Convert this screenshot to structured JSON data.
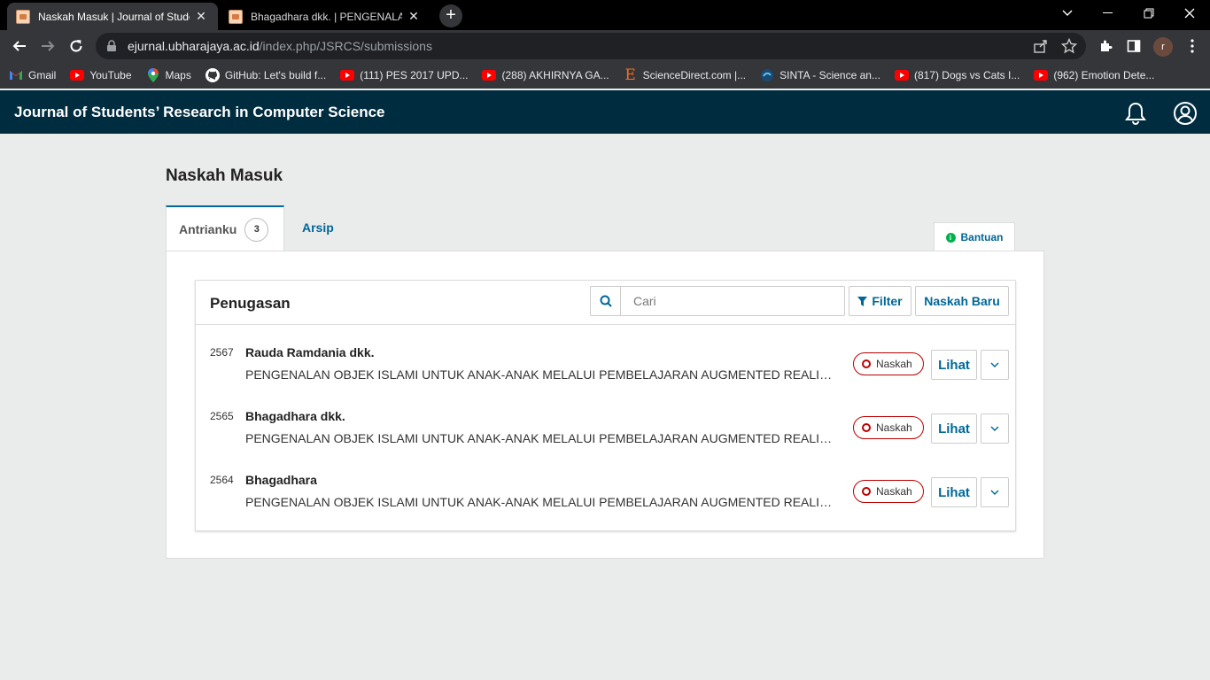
{
  "browser": {
    "tabs": [
      {
        "title": "Naskah Masuk | Journal of Students",
        "active": true
      },
      {
        "title": "Bhagadhara dkk. | PENGENALAN",
        "active": false
      }
    ],
    "url_host": "ejurnal.ubharajaya.ac.id",
    "url_path": "/index.php/JSRCS/submissions",
    "profile_initial": "r",
    "bookmarks": [
      {
        "label": "Gmail",
        "icon": "gmail-icon"
      },
      {
        "label": "YouTube",
        "icon": "youtube-icon"
      },
      {
        "label": "Maps",
        "icon": "maps-icon"
      },
      {
        "label": "GitHub: Let's build f...",
        "icon": "github-icon"
      },
      {
        "label": "(111) PES 2017 UPD...",
        "icon": "youtube-icon"
      },
      {
        "label": "(288) AKHIRNYA GA...",
        "icon": "youtube-icon"
      },
      {
        "label": "ScienceDirect.com |...",
        "icon": "elsevier-icon"
      },
      {
        "label": "SINTA - Science an...",
        "icon": "sinta-icon"
      },
      {
        "label": "(817) Dogs vs Cats I...",
        "icon": "youtube-icon"
      },
      {
        "label": "(962) Emotion Dete...",
        "icon": "youtube-icon"
      }
    ]
  },
  "app": {
    "title": "Journal of Students’ Research in Computer Science"
  },
  "page": {
    "title": "Naskah Masuk",
    "tabs": {
      "my_queue": "Antrianku",
      "my_queue_count": "3",
      "archive": "Arsip"
    },
    "help_label": "Bantuan"
  },
  "list": {
    "title": "Penugasan",
    "search_placeholder": "Cari",
    "filter_label": "Filter",
    "new_label": "Naskah Baru",
    "view_label": "Lihat",
    "items": [
      {
        "id": "2567",
        "author": "Rauda Ramdania dkk.",
        "title": "PENGENALAN OBJEK ISLAMI UNTUK ANAK-ANAK MELALUI PEMBELAJARAN AUGMENTED REALITY (A...",
        "stage": "Naskah"
      },
      {
        "id": "2565",
        "author": "Bhagadhara dkk.",
        "title": "PENGENALAN OBJEK ISLAMI UNTUK ANAK-ANAK MELALUI PEMBELAJARAN AUGMENTED REALITY (A...",
        "stage": "Naskah"
      },
      {
        "id": "2564",
        "author": "Bhagadhara",
        "title": "PENGENALAN OBJEK ISLAMI UNTUK ANAK-ANAK MELALUI PEMBELAJARAN AUGMENTED REALITY (A...",
        "stage": "Naskah"
      }
    ]
  },
  "colors": {
    "header_bg": "#002c40",
    "link": "#006798",
    "stage_border": "#bb0000",
    "page_bg": "#eaebeb"
  }
}
